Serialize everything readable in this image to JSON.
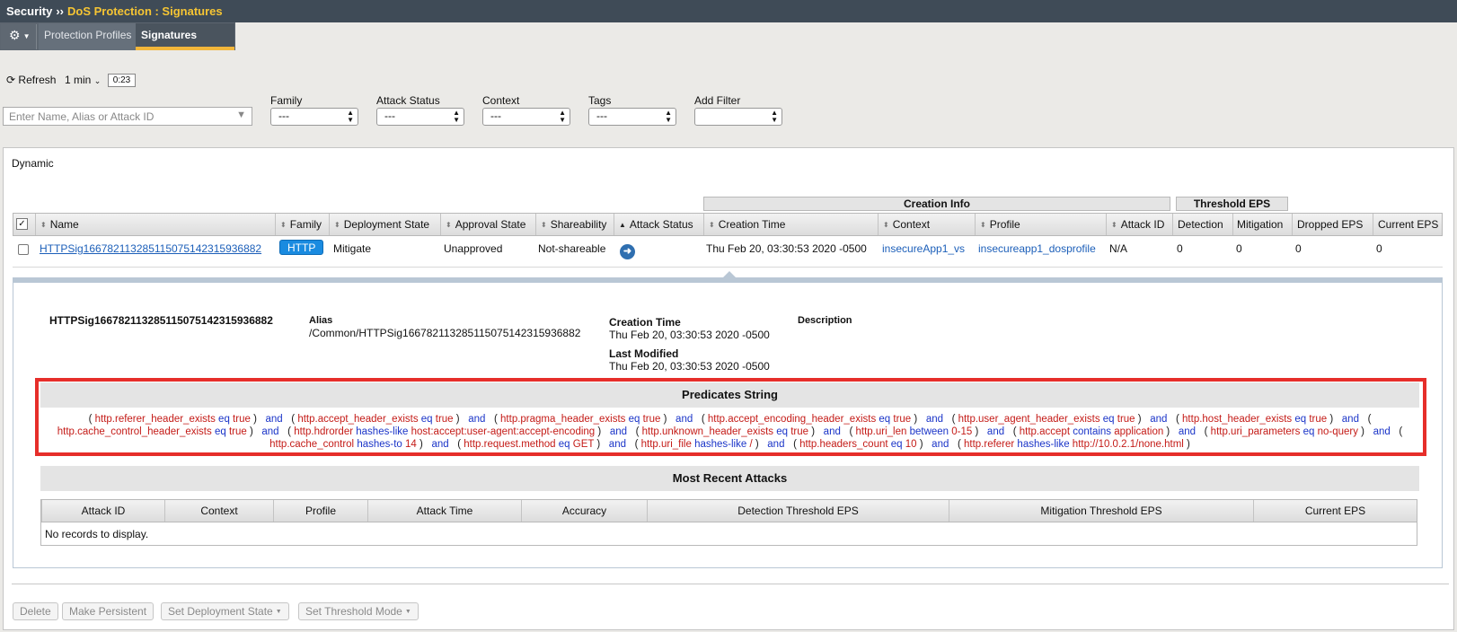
{
  "breadcrumb": {
    "root": "Security",
    "separator": "››",
    "current": "DoS Protection : Signatures"
  },
  "tabs": [
    {
      "label": "Protection Profiles"
    },
    {
      "label": "Signatures"
    }
  ],
  "toolbar": {
    "refresh_label": "Refresh",
    "interval": "1 min",
    "timer": "0:23"
  },
  "search": {
    "placeholder": "Enter Name, Alias or Attack ID",
    "value": ""
  },
  "filters": [
    {
      "label": "Family",
      "value": "---"
    },
    {
      "label": "Attack Status",
      "value": "---"
    },
    {
      "label": "Context",
      "value": "---"
    },
    {
      "label": "Tags",
      "value": "---"
    },
    {
      "label": "Add Filter",
      "value": ""
    }
  ],
  "panel_title": "Dynamic",
  "column_groups": {
    "creation_info": "Creation Info",
    "threshold_eps": "Threshold EPS"
  },
  "columns": {
    "name": "Name",
    "family": "Family",
    "deployment_state": "Deployment State",
    "approval_state": "Approval State",
    "shareability": "Shareability",
    "attack_status": "Attack Status",
    "creation_time": "Creation Time",
    "context": "Context",
    "profile": "Profile",
    "attack_id": "Attack ID",
    "detection": "Detection",
    "mitigation": "Mitigation",
    "dropped_eps": "Dropped EPS",
    "current_eps": "Current EPS"
  },
  "row": {
    "name": "HTTPSig16678211328511507514231593688​2",
    "family": "HTTP",
    "deployment_state": "Mitigate",
    "approval_state": "Unapproved",
    "shareability": "Not-shareable",
    "creation_time": "Thu Feb 20, 03:30:53 2020 -0500",
    "context": "insecureApp1_vs",
    "profile": "insecureapp1_dosprofile",
    "attack_id": "N/A",
    "detection": "0",
    "mitigation": "0",
    "dropped_eps": "0",
    "current_eps": "0"
  },
  "detail": {
    "name": "HTTPSig16678211328511507514231593688​2",
    "alias_label": "Alias",
    "alias_value": "/Common/HTTPSig16678211328511507514231593688​2",
    "creation_time_label": "Creation Time",
    "creation_time_value": "Thu Feb 20, 03:30:53 2020 -0500",
    "last_modified_label": "Last Modified",
    "last_modified_value": "Thu Feb 20, 03:30:53 2020 -0500",
    "description_label": "Description",
    "predicates_title": "Predicates String",
    "predicates": [
      {
        "field": "http.referer_header_exists",
        "op": "eq",
        "value": "true"
      },
      {
        "field": "http.accept_header_exists",
        "op": "eq",
        "value": "true"
      },
      {
        "field": "http.pragma_header_exists",
        "op": "eq",
        "value": "true"
      },
      {
        "field": "http.accept_encoding_header_exists",
        "op": "eq",
        "value": "true"
      },
      {
        "field": "http.user_agent_header_exists",
        "op": "eq",
        "value": "true"
      },
      {
        "field": "http.host_header_exists",
        "op": "eq",
        "value": "true"
      },
      {
        "field": "http.cache_control_header_exists",
        "op": "eq",
        "value": "true"
      },
      {
        "field": "http.hdrorder",
        "op": "hashes-like",
        "value": "host:accept:user-agent:accept-encoding"
      },
      {
        "field": "http.unknown_header_exists",
        "op": "eq",
        "value": "true"
      },
      {
        "field": "http.uri_len",
        "op": "between",
        "value": "0-15"
      },
      {
        "field": "http.accept",
        "op": "contains",
        "value": "application"
      },
      {
        "field": "http.uri_parameters",
        "op": "eq",
        "value": "no-query"
      },
      {
        "field": "http.cache_control",
        "op": "hashes-to",
        "value": "14"
      },
      {
        "field": "http.request.method",
        "op": "eq",
        "value": "GET"
      },
      {
        "field": "http.uri_file",
        "op": "hashes-like",
        "value": "/"
      },
      {
        "field": "http.headers_count",
        "op": "eq",
        "value": "10"
      },
      {
        "field": "http.referer",
        "op": "hashes-like",
        "value": "http://10.0.2.1/none.html"
      }
    ],
    "conjunction": "and",
    "recent_title": "Most Recent Attacks",
    "recent_columns": [
      "Attack ID",
      "Context",
      "Profile",
      "Attack Time",
      "Accuracy",
      "Detection Threshold EPS",
      "Mitigation Threshold EPS",
      "Current EPS"
    ],
    "recent_empty": "No records to display."
  },
  "footer_buttons": {
    "delete": "Delete",
    "make_persistent": "Make Persistent",
    "set_deployment_state": "Set Deployment State",
    "set_threshold_mode": "Set Threshold Mode"
  }
}
